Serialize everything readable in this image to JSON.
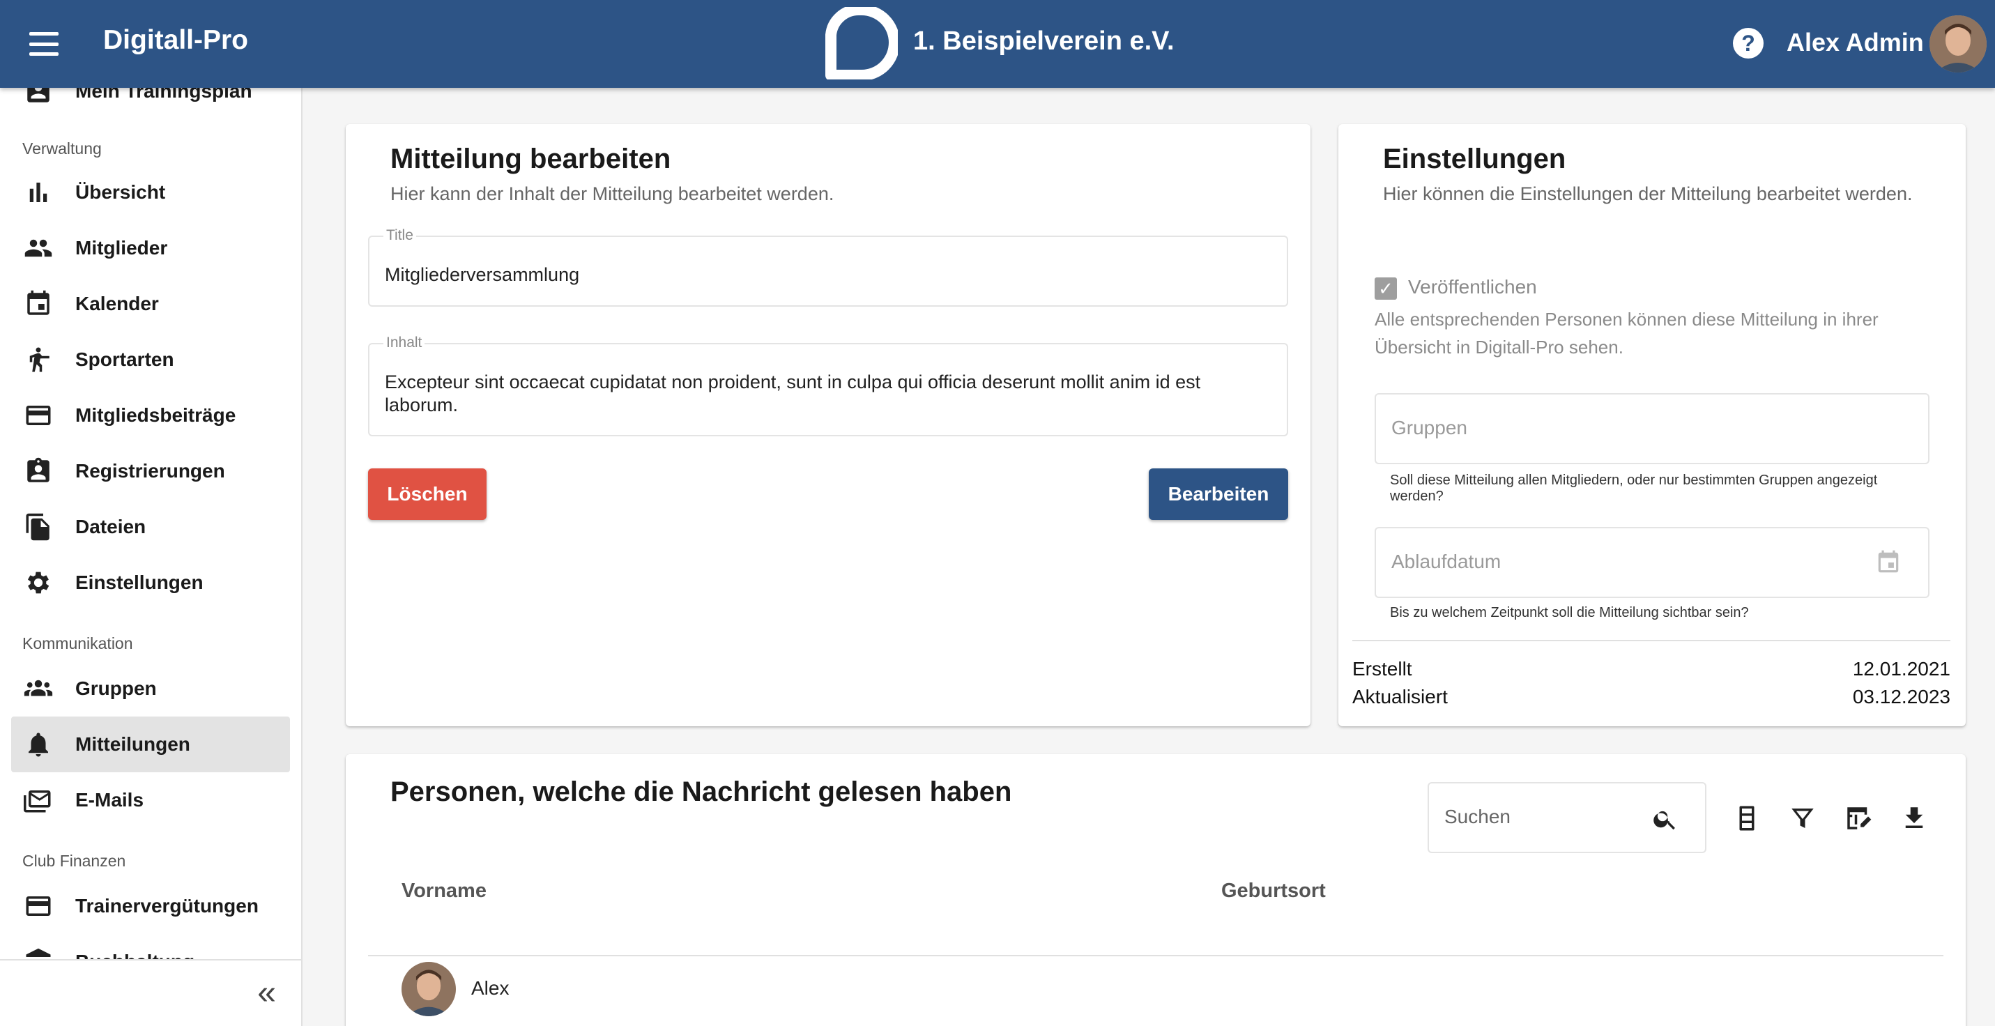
{
  "header": {
    "app_title": "Digitall-Pro",
    "club_name": "1. Beispielverein e.V.",
    "help_label": "?",
    "user_name": "Alex Admin",
    "brand_color": "#2d5486"
  },
  "sidebar": {
    "partial_top_item": "Mein Trainingsplan",
    "sections": {
      "verwaltung": "Verwaltung",
      "kommunikation": "Kommunikation",
      "club_finanzen": "Club Finanzen"
    },
    "items": {
      "uebersicht": "Übersicht",
      "mitglieder": "Mitglieder",
      "kalender": "Kalender",
      "sportarten": "Sportarten",
      "mitgliedsbeitraege": "Mitgliedsbeiträge",
      "registrierungen": "Registrierungen",
      "dateien": "Dateien",
      "einstellungen": "Einstellungen",
      "gruppen": "Gruppen",
      "mitteilungen": "Mitteilungen",
      "emails": "E-Mails",
      "trainerverguetungen": "Trainervergütungen",
      "partial_bottom": "Buchhaltung"
    },
    "active": "mitteilungen",
    "collapse_label": "«"
  },
  "edit_card": {
    "title": "Mitteilung bearbeiten",
    "subtitle": "Hier kann der Inhalt der Mitteilung bearbeitet werden.",
    "title_field": {
      "label": "Title",
      "value": "Mitgliederversammlung"
    },
    "content_field": {
      "label": "Inhalt",
      "value": "Excepteur sint occaecat cupidatat non proident, sunt in culpa qui officia deserunt mollit anim id est laborum."
    },
    "delete_label": "Löschen",
    "edit_label": "Bearbeiten",
    "delete_color": "#e05243"
  },
  "settings_card": {
    "title": "Einstellungen",
    "subtitle": "Hier können die Einstellungen der Mitteilung bearbeitet werden.",
    "publish_label": "Veröffentlichen",
    "publish_checked": true,
    "publish_description": "Alle entsprechenden Personen können diese Mitteilung in ihrer Übersicht in Digitall-Pro sehen.",
    "groups_placeholder": "Gruppen",
    "groups_helper": "Soll diese Mitteilung allen Mitgliedern, oder nur bestimmten Gruppen angezeigt werden?",
    "expiry_placeholder": "Ablaufdatum",
    "expiry_helper": "Bis zu welchem Zeitpunkt soll die Mitteilung sichtbar sein?",
    "created_label": "Erstellt",
    "created_value": "12.01.2021",
    "updated_label": "Aktualisiert",
    "updated_value": "03.12.2023"
  },
  "readers_card": {
    "title": "Personen, welche die Nachricht gelesen haben",
    "search_placeholder": "Suchen",
    "columns": [
      "Vorname",
      "Geburtsort"
    ],
    "rows": [
      {
        "first_name": "Alex",
        "birthplace": ""
      }
    ]
  }
}
